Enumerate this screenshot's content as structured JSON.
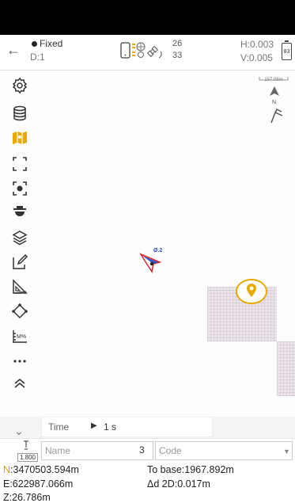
{
  "status": {
    "back_icon": "arrow-left-icon",
    "fix_type": "Fixed",
    "diff_age": "D:1",
    "sat_used": "26",
    "sat_visible": "33",
    "h_precision": "H:0.003",
    "v_precision": "V:0.005",
    "battery": "83"
  },
  "map": {
    "scale_label": "157.06m",
    "north_label": "N",
    "point_label": "Ø.2"
  },
  "toolbar_icons": [
    "gear-icon",
    "database-icon",
    "map-icon",
    "frame-icon",
    "focus-icon",
    "antenna-icon",
    "layers-icon",
    "edit-icon",
    "measure-icon",
    "polygon-icon",
    "ruler-icon",
    "more-icon",
    "collapse-up-icon"
  ],
  "bottom": {
    "time_label": "Time",
    "time_value": "1 s",
    "antenna_height": "1.800",
    "name_placeholder": "Name",
    "name_count": "3",
    "code_placeholder": "Code"
  },
  "coords": {
    "n_prefix": "N",
    "n_value": ":3470503.594m",
    "e": "E:622987.066m",
    "z": "Z:26.786m",
    "to_base": "To base:1967.892m",
    "delta_2d": "Δd 2D:0.017m"
  },
  "colors": {
    "accent": "#e8a800",
    "cursor": "#2a4fcf",
    "cursor_outline": "#d6262b"
  }
}
